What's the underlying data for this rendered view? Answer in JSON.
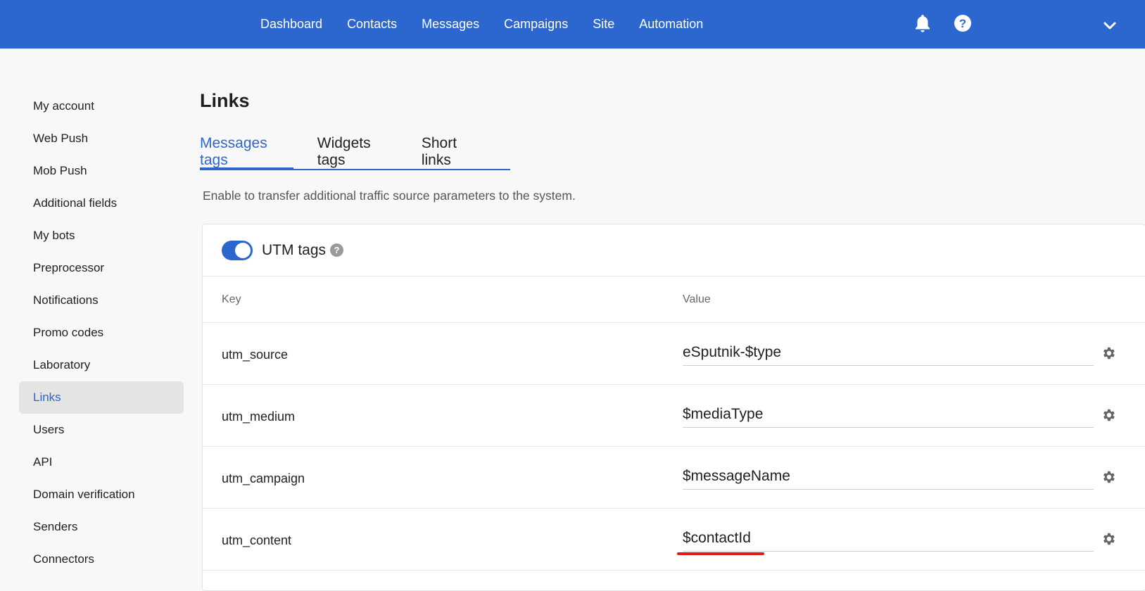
{
  "topnav": {
    "items": [
      "Dashboard",
      "Contacts",
      "Messages",
      "Campaigns",
      "Site",
      "Automation"
    ],
    "icons": [
      "bell-icon",
      "help-icon",
      "chevron-down-icon"
    ],
    "bg_color": "#2c66cf"
  },
  "sidebar": {
    "items": [
      "My account",
      "Web Push",
      "Mob Push",
      "Additional fields",
      "My bots",
      "Preprocessor",
      "Notifications",
      "Promo codes",
      "Laboratory",
      "Links",
      "Users",
      "API",
      "Domain verification",
      "Senders",
      "Connectors"
    ],
    "active": "Links"
  },
  "page": {
    "title": "Links",
    "tabs": [
      "Messages tags",
      "Widgets tags",
      "Short links"
    ],
    "active_tab": "Messages tags",
    "description": "Enable to transfer additional traffic source parameters to the system."
  },
  "utm": {
    "label": "UTM tags",
    "enabled": true,
    "columns": {
      "key": "Key",
      "value": "Value"
    },
    "rows": [
      {
        "key": "utm_source",
        "value": "eSputnik-$type"
      },
      {
        "key": "utm_medium",
        "value": "$mediaType"
      },
      {
        "key": "utm_campaign",
        "value": "$messageName"
      },
      {
        "key": "utm_content",
        "value": "$contactId"
      }
    ]
  },
  "colors": {
    "accent": "#2c66cf",
    "highlight": "#e01a1a"
  }
}
